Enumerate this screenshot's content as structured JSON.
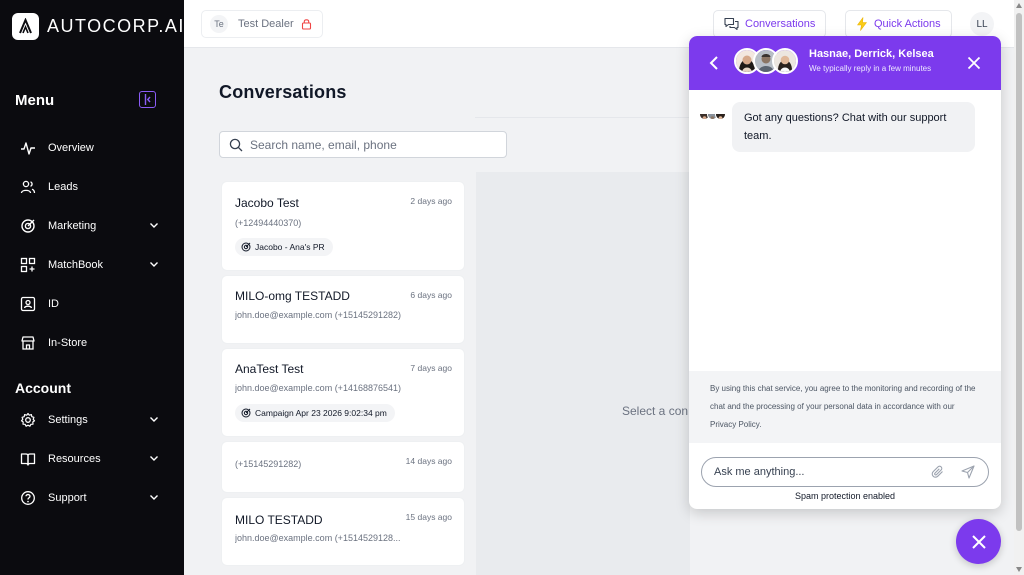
{
  "brand": {
    "logo_text": "AUTOCORP.AI",
    "accent": "#7c3aed"
  },
  "sidebar": {
    "menu_title": "Menu",
    "account_title": "Account",
    "items": [
      {
        "label": "Overview",
        "icon": "activity-icon"
      },
      {
        "label": "Leads",
        "icon": "users-icon"
      },
      {
        "label": "Marketing",
        "icon": "target-icon"
      },
      {
        "label": "MatchBook",
        "icon": "grid-plus-icon"
      },
      {
        "label": "ID",
        "icon": "id-card-icon"
      },
      {
        "label": "In-Store",
        "icon": "store-icon"
      }
    ],
    "account_items": [
      {
        "label": "Settings",
        "icon": "gear-icon"
      },
      {
        "label": "Resources",
        "icon": "book-icon"
      },
      {
        "label": "Support",
        "icon": "help-icon"
      }
    ]
  },
  "topbar": {
    "dealer_initials": "Te",
    "dealer_name": "Test Dealer",
    "conversations_label": "Conversations",
    "quick_actions_label": "Quick Actions",
    "user_initials": "LL"
  },
  "main": {
    "title": "Conversations",
    "search_placeholder": "Search name, email, phone",
    "select_text": "Select a con",
    "conversations": [
      {
        "name": "Jacobo Test",
        "sub": "(+12494440370)",
        "time": "2 days ago",
        "tag": "Jacobo - Ana's PR"
      },
      {
        "name": "MILO-omg TESTADD",
        "sub": "john.doe@example.com (+15145291282)",
        "time": "6 days ago",
        "tag": ""
      },
      {
        "name": "AnaTest Test",
        "sub": "john.doe@example.com (+14168876541)",
        "time": "7 days ago",
        "tag": "Campaign Apr 23 2026 9:02:34 pm"
      },
      {
        "name": "",
        "sub": "(+15145291282)",
        "time": "14 days ago",
        "tag": ""
      },
      {
        "name": "MILO TESTADD",
        "sub": "john.doe@example.com (+1514529128...",
        "time": "15 days ago",
        "tag": ""
      }
    ]
  },
  "chat": {
    "agents": "Hasnae, Derrick, Kelsea",
    "reply_time": "We typically reply in a few minutes",
    "message": "Got any questions? Chat with our support team.",
    "notice": "By using this chat service, you agree to the monitoring and recording of the chat and the processing of your personal data in accordance with our Privacy Policy.",
    "input_placeholder": "Ask me anything...",
    "spam": "Spam protection enabled"
  }
}
